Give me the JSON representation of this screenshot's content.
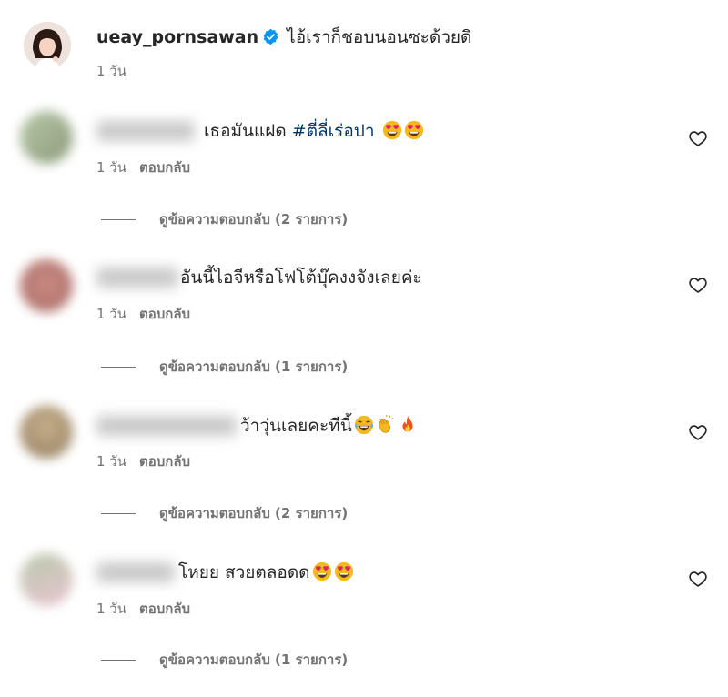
{
  "post": {
    "username": "ueay_pornsawan",
    "caption": "ไอ้เราก็ชอบนอนซะด้วยดิ",
    "time": "1 วัน"
  },
  "comments": [
    {
      "text": "เธอมันแฝด",
      "hashtag": "#ตี่ลี่เร่อปา",
      "emojis": [
        "heart-eyes-emoji",
        "heart-eyes-emoji"
      ],
      "time": "1 วัน",
      "reply_label": "ตอบกลับ",
      "view_replies": "ดูข้อความตอบกลับ (2 รายการ)"
    },
    {
      "text": "อันนี้ไอจีหรือโฟโต้บุ๊คงงจังเลยค่ะ",
      "hashtag": "",
      "emojis": [],
      "time": "1 วัน",
      "reply_label": "ตอบกลับ",
      "view_replies": "ดูข้อความตอบกลับ (1 รายการ)"
    },
    {
      "text": "ว้าวุ่นเลยคะทีนี้",
      "hashtag": "",
      "emojis": [
        "tears-of-joy-emoji",
        "clapping-hands-emoji",
        "fire-emoji"
      ],
      "time": "1 วัน",
      "reply_label": "ตอบกลับ",
      "view_replies": "ดูข้อความตอบกลับ (2 รายการ)"
    },
    {
      "text": "โหยย สวยตลอดด",
      "hashtag": "",
      "emojis": [
        "heart-eyes-emoji",
        "heart-eyes-emoji"
      ],
      "time": "1 วัน",
      "reply_label": "ตอบกลับ",
      "view_replies": "ดูข้อความตอบกลับ (1 รายการ)"
    }
  ],
  "colors": {
    "text": "#262626",
    "secondary": "#737373",
    "hashtag": "#00376b",
    "verified": "#0095f6"
  }
}
